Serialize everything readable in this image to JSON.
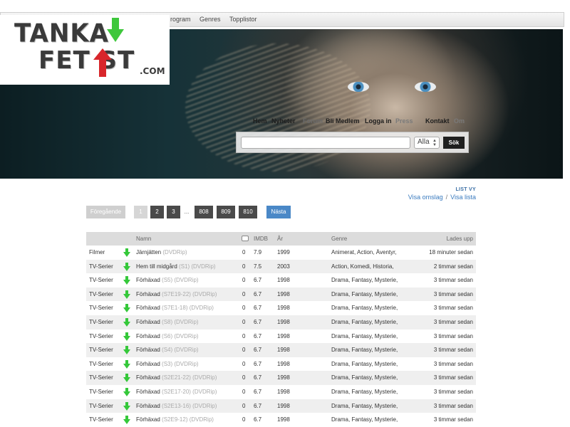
{
  "topnav": {
    "items": [
      "rogram",
      "Genres",
      "Topplistor"
    ]
  },
  "logo": {
    "line1": "TANKA",
    "line2": "FET ST",
    "dotcom": ".COM"
  },
  "mainnav": {
    "items": [
      "Hem",
      "Nyheter",
      "Forum",
      "Bli Medlem",
      "Logga in",
      "Press",
      "Kontakt",
      "Om"
    ]
  },
  "search": {
    "placeholder": "",
    "category": "Alla",
    "button": "Sök"
  },
  "view": {
    "title": "LIST VY",
    "cover": "Visa omslag",
    "separator": "/",
    "list": "Visa lista"
  },
  "pager": {
    "prev": "Föregående",
    "pages": [
      "1",
      "2",
      "3"
    ],
    "dots": "...",
    "tail": [
      "808",
      "809",
      "810"
    ],
    "next": "Nästa"
  },
  "table": {
    "headers": {
      "name": "Namn",
      "imdb": "IMDB",
      "year": "År",
      "genre": "Genre",
      "uploaded": "Lades upp"
    },
    "rows": [
      {
        "cat": "Filmer",
        "title": "Järnjätten",
        "tag": "(DVDRip)",
        "comments": "0",
        "imdb": "7.9",
        "year": "1999",
        "genre": "Animerat, Action, Äventyr,",
        "uploaded": "18 minuter sedan"
      },
      {
        "cat": "TV-Serier",
        "title": "Hem till midgård",
        "tag": "(S1) (DVDRip)",
        "comments": "0",
        "imdb": "7.5",
        "year": "2003",
        "genre": "Action, Komedi, Historia,",
        "uploaded": "2 timmar sedan"
      },
      {
        "cat": "TV-Serier",
        "title": "Förhäxad",
        "tag": "(S5) (DVDRip)",
        "comments": "0",
        "imdb": "6.7",
        "year": "1998",
        "genre": "Drama, Fantasy, Mysterie,",
        "uploaded": "3 timmar sedan"
      },
      {
        "cat": "TV-Serier",
        "title": "Förhäxad",
        "tag": "(S7E19-22) (DVDRip)",
        "comments": "0",
        "imdb": "6.7",
        "year": "1998",
        "genre": "Drama, Fantasy, Mysterie,",
        "uploaded": "3 timmar sedan"
      },
      {
        "cat": "TV-Serier",
        "title": "Förhäxad",
        "tag": "(S7E1-18) (DVDRip)",
        "comments": "0",
        "imdb": "6.7",
        "year": "1998",
        "genre": "Drama, Fantasy, Mysterie,",
        "uploaded": "3 timmar sedan"
      },
      {
        "cat": "TV-Serier",
        "title": "Förhäxad",
        "tag": "(S8) (DVDRip)",
        "comments": "0",
        "imdb": "6.7",
        "year": "1998",
        "genre": "Drama, Fantasy, Mysterie,",
        "uploaded": "3 timmar sedan"
      },
      {
        "cat": "TV-Serier",
        "title": "Förhäxad",
        "tag": "(S6) (DVDRip)",
        "comments": "0",
        "imdb": "6.7",
        "year": "1998",
        "genre": "Drama, Fantasy, Mysterie,",
        "uploaded": "3 timmar sedan"
      },
      {
        "cat": "TV-Serier",
        "title": "Förhäxad",
        "tag": "(S4) (DVDRip)",
        "comments": "0",
        "imdb": "6.7",
        "year": "1998",
        "genre": "Drama, Fantasy, Mysterie,",
        "uploaded": "3 timmar sedan"
      },
      {
        "cat": "TV-Serier",
        "title": "Förhäxad",
        "tag": "(S3) (DVDRip)",
        "comments": "0",
        "imdb": "6.7",
        "year": "1998",
        "genre": "Drama, Fantasy, Mysterie,",
        "uploaded": "3 timmar sedan"
      },
      {
        "cat": "TV-Serier",
        "title": "Förhäxad",
        "tag": "(S2E21-22) (DVDRip)",
        "comments": "0",
        "imdb": "6.7",
        "year": "1998",
        "genre": "Drama, Fantasy, Mysterie,",
        "uploaded": "3 timmar sedan"
      },
      {
        "cat": "TV-Serier",
        "title": "Förhäxad",
        "tag": "(S2E17-20) (DVDRip)",
        "comments": "0",
        "imdb": "6.7",
        "year": "1998",
        "genre": "Drama, Fantasy, Mysterie,",
        "uploaded": "3 timmar sedan"
      },
      {
        "cat": "TV-Serier",
        "title": "Förhäxad",
        "tag": "(S2E13-16) (DVDRip)",
        "comments": "0",
        "imdb": "6.7",
        "year": "1998",
        "genre": "Drama, Fantasy, Mysterie,",
        "uploaded": "3 timmar sedan"
      },
      {
        "cat": "TV-Serier",
        "title": "Förhäxad",
        "tag": "(S2E9-12) (DVDRip)",
        "comments": "0",
        "imdb": "6.7",
        "year": "1998",
        "genre": "Drama, Fantasy, Mysterie,",
        "uploaded": "3 timmar sedan"
      }
    ]
  },
  "colors": {
    "accent": "#4a88c7",
    "download": "#35c83a",
    "link": "#3a7bbf"
  },
  "icons": {
    "download": "green-down-arrow-icon",
    "comments": "speech-bubble-icon"
  }
}
